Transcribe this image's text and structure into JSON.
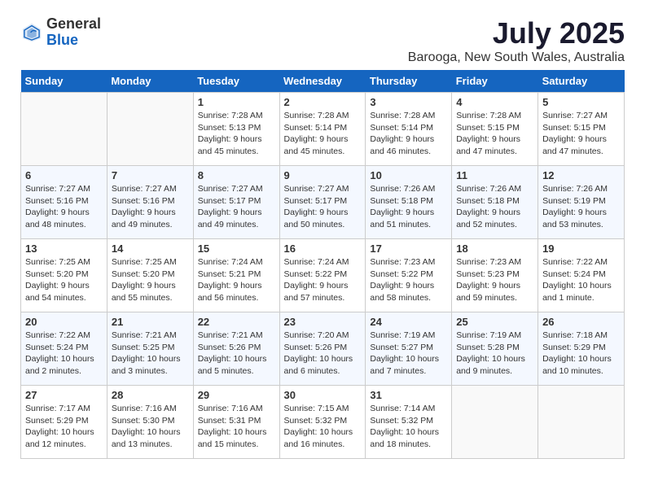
{
  "logo": {
    "general": "General",
    "blue": "Blue"
  },
  "title": "July 2025",
  "location": "Barooga, New South Wales, Australia",
  "days_of_week": [
    "Sunday",
    "Monday",
    "Tuesday",
    "Wednesday",
    "Thursday",
    "Friday",
    "Saturday"
  ],
  "weeks": [
    [
      {
        "day": "",
        "info": ""
      },
      {
        "day": "",
        "info": ""
      },
      {
        "day": "1",
        "info": "Sunrise: 7:28 AM\nSunset: 5:13 PM\nDaylight: 9 hours\nand 45 minutes."
      },
      {
        "day": "2",
        "info": "Sunrise: 7:28 AM\nSunset: 5:14 PM\nDaylight: 9 hours\nand 45 minutes."
      },
      {
        "day": "3",
        "info": "Sunrise: 7:28 AM\nSunset: 5:14 PM\nDaylight: 9 hours\nand 46 minutes."
      },
      {
        "day": "4",
        "info": "Sunrise: 7:28 AM\nSunset: 5:15 PM\nDaylight: 9 hours\nand 47 minutes."
      },
      {
        "day": "5",
        "info": "Sunrise: 7:27 AM\nSunset: 5:15 PM\nDaylight: 9 hours\nand 47 minutes."
      }
    ],
    [
      {
        "day": "6",
        "info": "Sunrise: 7:27 AM\nSunset: 5:16 PM\nDaylight: 9 hours\nand 48 minutes."
      },
      {
        "day": "7",
        "info": "Sunrise: 7:27 AM\nSunset: 5:16 PM\nDaylight: 9 hours\nand 49 minutes."
      },
      {
        "day": "8",
        "info": "Sunrise: 7:27 AM\nSunset: 5:17 PM\nDaylight: 9 hours\nand 49 minutes."
      },
      {
        "day": "9",
        "info": "Sunrise: 7:27 AM\nSunset: 5:17 PM\nDaylight: 9 hours\nand 50 minutes."
      },
      {
        "day": "10",
        "info": "Sunrise: 7:26 AM\nSunset: 5:18 PM\nDaylight: 9 hours\nand 51 minutes."
      },
      {
        "day": "11",
        "info": "Sunrise: 7:26 AM\nSunset: 5:18 PM\nDaylight: 9 hours\nand 52 minutes."
      },
      {
        "day": "12",
        "info": "Sunrise: 7:26 AM\nSunset: 5:19 PM\nDaylight: 9 hours\nand 53 minutes."
      }
    ],
    [
      {
        "day": "13",
        "info": "Sunrise: 7:25 AM\nSunset: 5:20 PM\nDaylight: 9 hours\nand 54 minutes."
      },
      {
        "day": "14",
        "info": "Sunrise: 7:25 AM\nSunset: 5:20 PM\nDaylight: 9 hours\nand 55 minutes."
      },
      {
        "day": "15",
        "info": "Sunrise: 7:24 AM\nSunset: 5:21 PM\nDaylight: 9 hours\nand 56 minutes."
      },
      {
        "day": "16",
        "info": "Sunrise: 7:24 AM\nSunset: 5:22 PM\nDaylight: 9 hours\nand 57 minutes."
      },
      {
        "day": "17",
        "info": "Sunrise: 7:23 AM\nSunset: 5:22 PM\nDaylight: 9 hours\nand 58 minutes."
      },
      {
        "day": "18",
        "info": "Sunrise: 7:23 AM\nSunset: 5:23 PM\nDaylight: 9 hours\nand 59 minutes."
      },
      {
        "day": "19",
        "info": "Sunrise: 7:22 AM\nSunset: 5:24 PM\nDaylight: 10 hours\nand 1 minute."
      }
    ],
    [
      {
        "day": "20",
        "info": "Sunrise: 7:22 AM\nSunset: 5:24 PM\nDaylight: 10 hours\nand 2 minutes."
      },
      {
        "day": "21",
        "info": "Sunrise: 7:21 AM\nSunset: 5:25 PM\nDaylight: 10 hours\nand 3 minutes."
      },
      {
        "day": "22",
        "info": "Sunrise: 7:21 AM\nSunset: 5:26 PM\nDaylight: 10 hours\nand 5 minutes."
      },
      {
        "day": "23",
        "info": "Sunrise: 7:20 AM\nSunset: 5:26 PM\nDaylight: 10 hours\nand 6 minutes."
      },
      {
        "day": "24",
        "info": "Sunrise: 7:19 AM\nSunset: 5:27 PM\nDaylight: 10 hours\nand 7 minutes."
      },
      {
        "day": "25",
        "info": "Sunrise: 7:19 AM\nSunset: 5:28 PM\nDaylight: 10 hours\nand 9 minutes."
      },
      {
        "day": "26",
        "info": "Sunrise: 7:18 AM\nSunset: 5:29 PM\nDaylight: 10 hours\nand 10 minutes."
      }
    ],
    [
      {
        "day": "27",
        "info": "Sunrise: 7:17 AM\nSunset: 5:29 PM\nDaylight: 10 hours\nand 12 minutes."
      },
      {
        "day": "28",
        "info": "Sunrise: 7:16 AM\nSunset: 5:30 PM\nDaylight: 10 hours\nand 13 minutes."
      },
      {
        "day": "29",
        "info": "Sunrise: 7:16 AM\nSunset: 5:31 PM\nDaylight: 10 hours\nand 15 minutes."
      },
      {
        "day": "30",
        "info": "Sunrise: 7:15 AM\nSunset: 5:32 PM\nDaylight: 10 hours\nand 16 minutes."
      },
      {
        "day": "31",
        "info": "Sunrise: 7:14 AM\nSunset: 5:32 PM\nDaylight: 10 hours\nand 18 minutes."
      },
      {
        "day": "",
        "info": ""
      },
      {
        "day": "",
        "info": ""
      }
    ]
  ]
}
